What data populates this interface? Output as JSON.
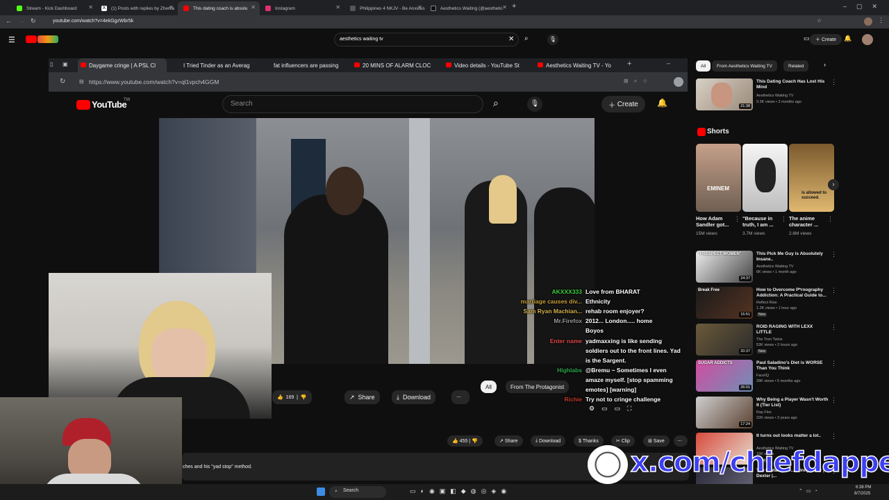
{
  "browser": {
    "tabs": [
      {
        "label": "Stream - Kick Dashboard",
        "color": "#53fc18"
      },
      {
        "label": "(1) Posts with replies by Zherka",
        "color": "#ffffff"
      },
      {
        "label": "This dating coach is absolu",
        "color": "#ff0000"
      },
      {
        "label": "Instagram",
        "color": "#e1306c"
      },
      {
        "label": "Philippines 4 NKJV - Be Anxious",
        "color": "#cfcfcf"
      },
      {
        "label": "Aesthetics Waiting (@aesthetic",
        "color": "#ffffff"
      }
    ],
    "url": "youtube.com/watch?v=4ekGgzWbr5k"
  },
  "youtube": {
    "search_value": "aesthetics waiting tv",
    "create_label": "Create"
  },
  "inner_browser": {
    "tabs": [
      "Daygame cringe | A PSL Cl",
      "I Tried Tinder as an Averag",
      "fat influencers are passing",
      "20 MINS OF ALARM CLOC",
      "Video details - YouTube St",
      "Aesthetics Waiting TV - Yo"
    ],
    "url": "https://www.youtube.com/watch?v=ql1vpch4GGM",
    "logo": "YouTube",
    "logo_suffix": "TW",
    "search_placeholder": "Search",
    "create_label": "Create",
    "likes": "169",
    "share_label": "Share",
    "download_label": "Download",
    "chips": [
      "All",
      "From The Protagonist"
    ]
  },
  "chat": [
    {
      "user": "AKXXX333",
      "user_color": "#3ad13a",
      "message": "Love from BHARAT"
    },
    {
      "user": "marriage causes div...",
      "user_color": "#c8a038",
      "message": "Ethnicity"
    },
    {
      "user": "Sam Ryan Machian...",
      "user_color": "#d6b24c",
      "message": "rehab room enjoyer?"
    },
    {
      "user": "Mr.Firefox",
      "user_color": "#9a9a9a",
      "message": "2012... London..... home"
    },
    {
      "user": "",
      "user_color": "#d23a3a",
      "message": "Boyos"
    },
    {
      "user": "Enter name",
      "user_color": "#e04848",
      "message": "yadmaxxing is like sending"
    },
    {
      "user": "",
      "user_color": "#ffffff",
      "message": "soldiers out to the front lines. Yad"
    },
    {
      "user": "",
      "user_color": "#ffffff",
      "message": "is the Sargent."
    },
    {
      "user": "Highlabs",
      "user_color": "#2ea84a",
      "message": "@Bremu ~ Sometimes I even"
    },
    {
      "user": "",
      "user_color": "#ffffff",
      "message": "amaze myself. [stop spamming"
    },
    {
      "user": "",
      "user_color": "#ffffff",
      "message": "emotes] [warning]"
    },
    {
      "user": "Richie",
      "user_color": "#c0392b",
      "message": "Try not to cringe challenge"
    }
  ],
  "sidebar": {
    "chips": [
      "All",
      "From Aesthetics Waiting TV",
      "Related"
    ],
    "top_video": {
      "title": "This Dating Coach Has Lost His Mind",
      "channel": "Aesthetics Waiting TV",
      "meta": "9.3K views • 2 months ago",
      "duration": "21:38"
    },
    "shorts_label": "Shorts",
    "shorts": [
      {
        "title": "How Adam Sandler got...",
        "views": "15M views",
        "caption": "EMINEM"
      },
      {
        "title": "\"Because in truth, I am ...",
        "views": "3.7M views",
        "caption": ""
      },
      {
        "title": "The anime character ...",
        "views": "2.6M views",
        "caption": "is allowed to succeed."
      }
    ],
    "videos": [
      {
        "title": "This Pick Me Guy is Absolutely Insane..",
        "channel": "Aesthetics Waiting TV",
        "meta": "6K views • 1 month ago",
        "duration": "24:37",
        "thumb_text": "\"I RESPECT WOMEN\"",
        "badge": ""
      },
      {
        "title": "How to Overcome P*rnography Addiction: A Practical Guide to...",
        "channel": "Reflect Rise",
        "meta": "1.2K views • 1 hour ago",
        "duration": "15:51",
        "thumb_text": "Break Free",
        "badge": "New"
      },
      {
        "title": "ROID RAGING WITH LEXX LITTLE",
        "channel": "The Tren Twins",
        "meta": "53K views • 2 hours ago",
        "duration": "20:37",
        "thumb_text": "",
        "badge": "New"
      },
      {
        "title": "Paul Saladino's Diet is WORSE Than You Think",
        "channel": "FaceIQ",
        "meta": "28K views • 5 months ago",
        "duration": "26:01",
        "thumb_text": "SUGAR ADDICTS",
        "badge": ""
      },
      {
        "title": "Why Being a Player Wasn't Worth It (Tier List)",
        "channel": "Ray Flex",
        "meta": "22K views • 3 years ago",
        "duration": "17:24",
        "thumb_text": "",
        "badge": ""
      },
      {
        "title": "It turns out looks matter a lot..",
        "channel": "Aesthetics Waiting TV",
        "meta": "15K views",
        "duration": "",
        "thumb_text": "",
        "badge": "New"
      },
      {
        "title": "The Brutality of ... Trinity Killer | Dexter |...",
        "channel": "",
        "meta": "",
        "duration": "",
        "thumb_text": "",
        "badge": ""
      }
    ]
  },
  "outer_actions": {
    "likes": "455",
    "share": "Share",
    "download": "Download",
    "thanks": "Thanks",
    "clip": "Clip",
    "save": "Save"
  },
  "description_snippet": "ches and his \"yad stop\" method.",
  "watermark": "x.com/chiefdapper",
  "taskbar": {
    "search_label": "Search",
    "time": "6:38 PM",
    "date": "8/7/2025"
  },
  "colors": {
    "youtube_red": "#ff0000",
    "watermark_blue": "#3d3ff0",
    "bg": "#0f0f0f"
  }
}
